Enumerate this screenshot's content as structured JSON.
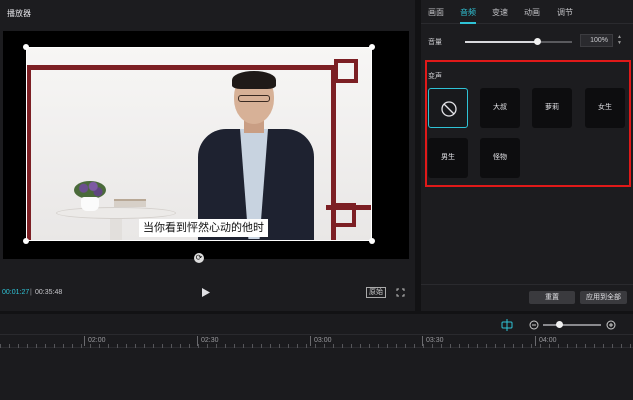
{
  "player": {
    "title": "播放器",
    "subtitle": "当你看到怦然心动的他时",
    "time_current": "00:01:27",
    "time_separator": "|",
    "time_total": "00:35:48",
    "ratio_label": "原始",
    "icons": [
      "rotate-icon",
      "play-icon",
      "fullscreen-icon"
    ]
  },
  "properties": {
    "tabs": [
      {
        "label": "画面",
        "active": false
      },
      {
        "label": "音频",
        "active": true
      },
      {
        "label": "变速",
        "active": false
      },
      {
        "label": "动画",
        "active": false
      },
      {
        "label": "调节",
        "active": false
      }
    ],
    "volume": {
      "label": "音量",
      "value": "100%",
      "level_fraction": 0.67
    },
    "voice_change": {
      "title": "变声",
      "options": [
        {
          "label": "",
          "icon": "none-icon",
          "selected": true
        },
        {
          "label": "大叔",
          "selected": false
        },
        {
          "label": "萝莉",
          "selected": false
        },
        {
          "label": "女生",
          "selected": false
        },
        {
          "label": "男生",
          "selected": false
        },
        {
          "label": "怪物",
          "selected": false
        }
      ]
    },
    "reset_label": "重置",
    "apply_all_label": "应用到全部"
  },
  "timeline": {
    "ruler_labels": [
      "02:00",
      "02:30",
      "03:00",
      "03:30",
      "04:00"
    ],
    "zoom_level_fraction": 0.28
  },
  "colors": {
    "accent": "#2fc3d6",
    "highlight_box": "#e01919",
    "panel_bg": "#1c1c1f"
  }
}
